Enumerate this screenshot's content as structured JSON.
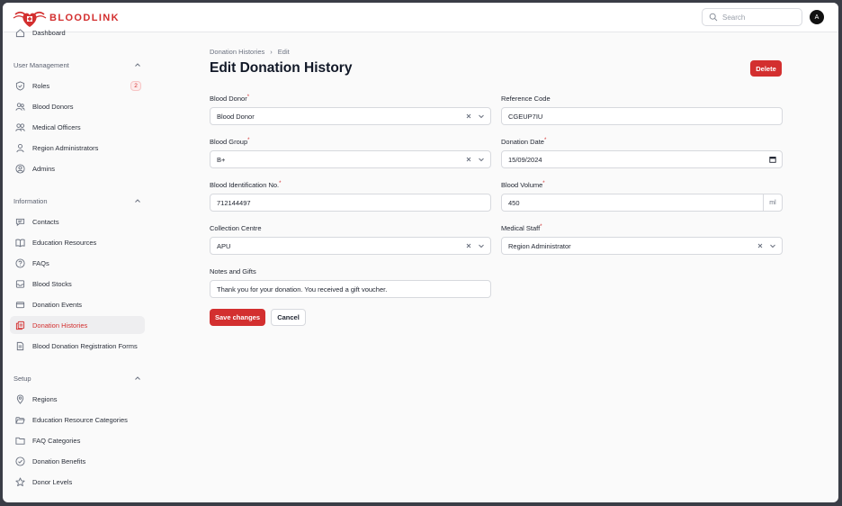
{
  "app": {
    "brand": "BLOODLINK"
  },
  "search": {
    "placeholder": "Search"
  },
  "user": {
    "avatar_initial": "A"
  },
  "sidebar": {
    "partial_item": "Dashboard",
    "groups": [
      {
        "label": "User Management",
        "items": [
          {
            "label": "Roles",
            "icon": "shield-icon",
            "badge": "2"
          },
          {
            "label": "Blood Donors",
            "icon": "users-icon"
          },
          {
            "label": "Medical Officers",
            "icon": "user-group-icon"
          },
          {
            "label": "Region Administrators",
            "icon": "user-icon"
          },
          {
            "label": "Admins",
            "icon": "user-circle-icon"
          }
        ]
      },
      {
        "label": "Information",
        "items": [
          {
            "label": "Contacts",
            "icon": "chat-icon"
          },
          {
            "label": "Education Resources",
            "icon": "book-icon"
          },
          {
            "label": "FAQs",
            "icon": "question-icon"
          },
          {
            "label": "Blood Stocks",
            "icon": "inbox-icon"
          },
          {
            "label": "Donation Events",
            "icon": "rectangle-icon"
          },
          {
            "label": "Donation Histories",
            "icon": "document-duplicate-icon",
            "active": true
          },
          {
            "label": "Blood Donation Registration Forms",
            "icon": "document-icon"
          }
        ]
      },
      {
        "label": "Setup",
        "items": [
          {
            "label": "Regions",
            "icon": "map-pin-icon"
          },
          {
            "label": "Education Resource Categories",
            "icon": "folder-open-icon"
          },
          {
            "label": "FAQ Categories",
            "icon": "folder-icon"
          },
          {
            "label": "Donation Benefits",
            "icon": "check-circle-icon"
          },
          {
            "label": "Donor Levels",
            "icon": "star-icon"
          }
        ]
      }
    ]
  },
  "breadcrumb": {
    "parent": "Donation Histories",
    "separator": "›",
    "current": "Edit"
  },
  "page": {
    "title": "Edit Donation History",
    "delete_label": "Delete"
  },
  "form": {
    "blood_donor": {
      "label": "Blood Donor",
      "required": "*",
      "value": "Blood Donor"
    },
    "reference_code": {
      "label": "Reference Code",
      "value": "CGEUP7IU"
    },
    "blood_group": {
      "label": "Blood Group",
      "required": "*",
      "value": "B+"
    },
    "donation_date": {
      "label": "Donation Date",
      "required": "*",
      "value": "15/09/2024"
    },
    "blood_identification": {
      "label": "Blood Identification No.",
      "required": "*",
      "value": "712144497"
    },
    "blood_volume": {
      "label": "Blood Volume",
      "required": "*",
      "value": "450",
      "unit": "ml"
    },
    "collection_centre": {
      "label": "Collection Centre",
      "value": "APU"
    },
    "medical_staff": {
      "label": "Medical Staff",
      "required": "*",
      "value": "Region Administrator"
    },
    "notes": {
      "label": "Notes and Gifts",
      "value": "Thank you for your donation. You received a gift voucher."
    },
    "save_label": "Save changes",
    "cancel_label": "Cancel"
  },
  "colors": {
    "accent": "#d32f2f",
    "active_bg": "#eeeef0"
  }
}
